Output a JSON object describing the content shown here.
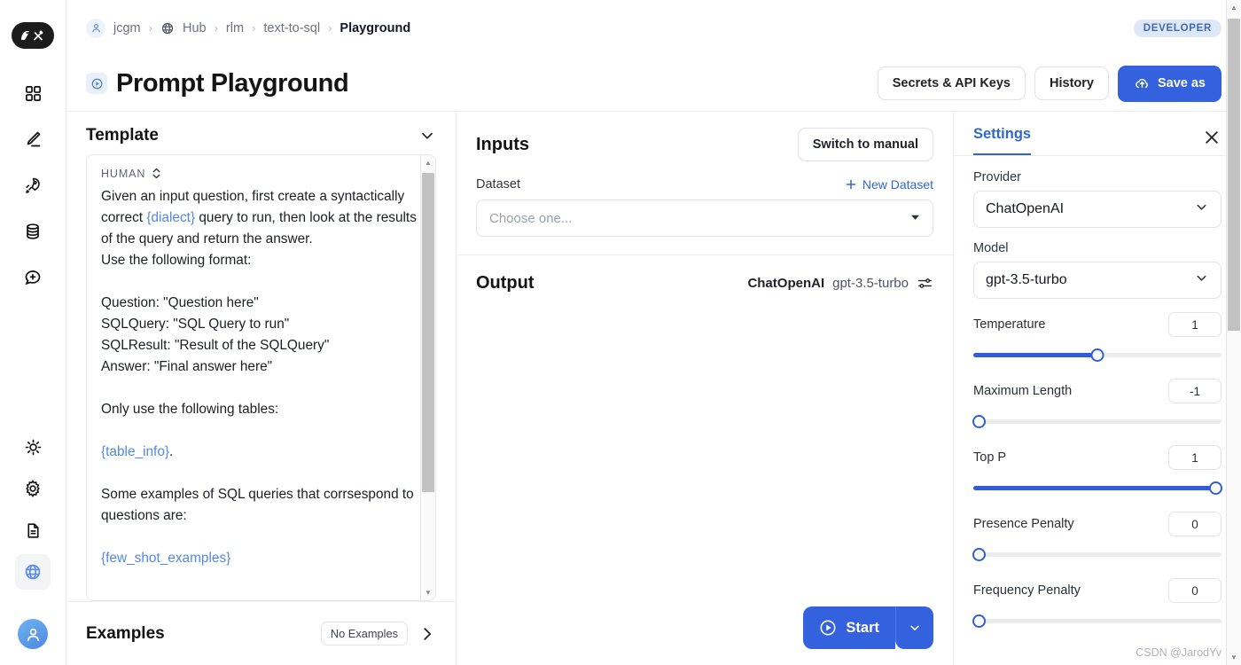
{
  "rail": {
    "logo_name": "langchain-logo",
    "items": [
      {
        "icon": "grid-icon",
        "name": "sidebar-item-dashboard"
      },
      {
        "icon": "pencil-icon",
        "name": "sidebar-item-edit"
      },
      {
        "icon": "rocket-icon",
        "name": "sidebar-item-deployments"
      },
      {
        "icon": "database-icon",
        "name": "sidebar-item-datasets"
      },
      {
        "icon": "chat-plus-icon",
        "name": "sidebar-item-annotations"
      }
    ],
    "bottom_items": [
      {
        "icon": "sun-icon",
        "name": "sidebar-item-theme"
      },
      {
        "icon": "gear-icon",
        "name": "sidebar-item-settings"
      },
      {
        "icon": "document-icon",
        "name": "sidebar-item-docs"
      },
      {
        "icon": "globe-icon",
        "name": "sidebar-item-language",
        "active": true
      }
    ],
    "avatar_icon": "user-avatar-icon"
  },
  "breadcrumb": {
    "user_icon": "user-circle-icon",
    "items": [
      {
        "label": "jcgm",
        "icon": "user-circle-icon"
      },
      {
        "label": "Hub",
        "icon": "globe-icon"
      },
      {
        "label": "rlm",
        "icon": ""
      },
      {
        "label": "text-to-sql",
        "icon": ""
      },
      {
        "label": "Playground",
        "icon": "",
        "current": true
      }
    ],
    "separator": "›",
    "badge": "DEVELOPER"
  },
  "header": {
    "title": "Prompt Playground",
    "title_icon": "play-circle-icon",
    "secrets_label": "Secrets & API Keys",
    "history_label": "History",
    "save_label": "Save as",
    "save_icon": "cloud-upload-icon"
  },
  "template": {
    "heading": "Template",
    "collapse_icon": "chevron-down-icon",
    "role": "HUMAN",
    "role_selector_icon": "chevron-up-down-icon",
    "lines": [
      {
        "t": "Given an input question, first create a syntactically correct "
      },
      {
        "t": "{dialect}",
        "token": true
      },
      {
        "t": " query to run, then look at the results of the query and return the answer.\nUse the following format:\n\nQuestion: \"Question here\"\nSQLQuery: \"SQL Query to run\"\nSQLResult: \"Result of the SQLQuery\"\nAnswer: \"Final answer here\"\n\nOnly use the following tables:\n\n"
      },
      {
        "t": "{table_info}",
        "token": true
      },
      {
        "t": ".\n\nSome examples of SQL queries that corrsespond to questions are:\n\n"
      },
      {
        "t": "{few_shot_examples}",
        "token": true
      }
    ]
  },
  "examples": {
    "heading": "Examples",
    "badge": "No Examples",
    "expand_icon": "chevron-right-icon"
  },
  "inputs": {
    "heading": "Inputs",
    "switch_label": "Switch to manual",
    "dataset_label": "Dataset",
    "new_dataset_label": "New Dataset",
    "new_dataset_icon": "plus-icon",
    "dataset_placeholder": "Choose one...",
    "dataset_value": "",
    "caret_icon": "caret-down-icon"
  },
  "output": {
    "heading": "Output",
    "provider": "ChatOpenAI",
    "model": "gpt-3.5-turbo",
    "tune_icon": "sliders-icon",
    "start_label": "Start",
    "start_icon": "play-circle-icon",
    "start_caret_icon": "chevron-down-icon"
  },
  "settings": {
    "tab_label": "Settings",
    "close_icon": "close-icon",
    "provider_label": "Provider",
    "provider_value": "ChatOpenAI",
    "model_label": "Model",
    "model_value": "gpt-3.5-turbo",
    "dropdown_icon": "chevron-down-icon",
    "sliders": [
      {
        "label": "Temperature",
        "value": "1",
        "pct": 50
      },
      {
        "label": "Maximum Length",
        "value": "-1",
        "pct": 0
      },
      {
        "label": "Top P",
        "value": "1",
        "pct": 100
      },
      {
        "label": "Presence Penalty",
        "value": "0",
        "pct": 0
      },
      {
        "label": "Frequency Penalty",
        "value": "0",
        "pct": 0
      }
    ]
  },
  "watermark": "CSDN @JarodYv",
  "colors": {
    "accent": "#3461dd",
    "link": "#2f68cd",
    "token": "#5189e0",
    "badge_bg": "#dde7f5",
    "badge_fg": "#3f6ab1"
  }
}
